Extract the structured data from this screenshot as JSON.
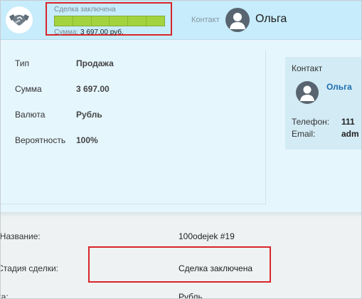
{
  "header": {
    "stage_label": "Сделка заключена",
    "progress": {
      "filled_segments": 6,
      "total_segments": 6,
      "fraction": 1.0,
      "color": "#a3d43d"
    },
    "sum_label": "Сумма:",
    "sum_value": "3 697.00 руб.",
    "contact_label": "Контакт",
    "contact_name": "Ольга",
    "deal_icon": "handshake-icon",
    "highlight_color": "#d8262a"
  },
  "fields": [
    {
      "label": "Тип",
      "value": "Продажа"
    },
    {
      "label": "Сумма",
      "value": "3 697.00"
    },
    {
      "label": "Валюта",
      "value": "Рубль"
    },
    {
      "label": "Вероятность",
      "value": "100%"
    }
  ],
  "contact_card": {
    "title": "Контакт",
    "name": "Ольга",
    "phone_label": "Телефон:",
    "phone_value": "111",
    "email_label": "Email:",
    "email_value": "adm",
    "avatar_icon": "user-icon"
  },
  "details": [
    {
      "label": "Название:",
      "value": "100odejek #19"
    },
    {
      "label": "Стадия сделки:",
      "value": "Сделка заключена"
    },
    {
      "label": "Валюта:",
      "value": "Рубль"
    }
  ],
  "colors": {
    "header_bg": "#c7ecfb",
    "panel_bg": "#e5f6fd",
    "link": "#1e6db2"
  }
}
